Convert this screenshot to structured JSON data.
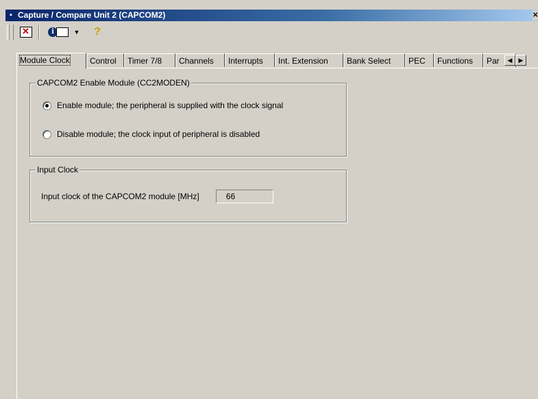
{
  "window": {
    "title": "Capture / Compare Unit 2 (CAPCOM2)",
    "title_bar_color": "#0a246a",
    "background": "#d4d0c8"
  },
  "toolbar": {
    "buttons": [
      {
        "icon": "delete-icon"
      },
      {
        "icon": "info-book-icon"
      },
      {
        "icon": "dropdown-arrow-icon"
      },
      {
        "icon": "help-icon"
      }
    ]
  },
  "tabs": [
    {
      "label": "Module Clock",
      "active": true
    },
    {
      "label": "Control"
    },
    {
      "label": "Timer 7/8"
    },
    {
      "label": "Channels"
    },
    {
      "label": "Interrupts"
    },
    {
      "label": "Int. Extension"
    },
    {
      "label": "Bank Select"
    },
    {
      "label": "PEC"
    },
    {
      "label": "Functions"
    },
    {
      "label": "Par"
    }
  ],
  "enable_group": {
    "legend": "CAPCOM2 Enable Module (CC2MODEN)",
    "options": [
      {
        "label": "Enable module; the peripheral is supplied with the clock signal",
        "checked": true
      },
      {
        "label": "Disable module; the clock input of peripheral is disabled",
        "checked": false
      }
    ]
  },
  "input_clock_group": {
    "legend": "Input Clock",
    "label": "Input clock of the CAPCOM2 module [MHz]",
    "value": "66"
  }
}
